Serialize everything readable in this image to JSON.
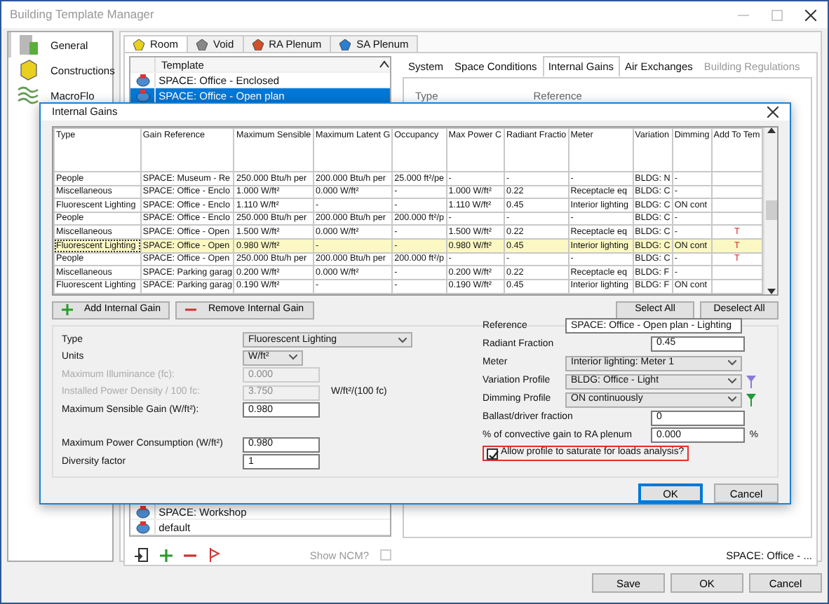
{
  "window": {
    "title": "Building Template Manager"
  },
  "sidebar": {
    "items": [
      {
        "label": "General",
        "selected": true
      },
      {
        "label": "Constructions",
        "selected": false
      },
      {
        "label": "MacroFlo",
        "selected": false
      }
    ]
  },
  "category_tabs": [
    {
      "label": "Room",
      "selected": true
    },
    {
      "label": "Void",
      "selected": false
    },
    {
      "label": "RA Plenum",
      "selected": false
    },
    {
      "label": "SA Plenum",
      "selected": false
    }
  ],
  "template_list": {
    "header": "Template",
    "items_top": [
      {
        "label": "SPACE: Office - Enclosed",
        "selected": false
      },
      {
        "label": "SPACE: Office - Open plan",
        "selected": true
      }
    ],
    "items_bottom": [
      {
        "label": "SPACE: Workshop",
        "selected": false
      },
      {
        "label": "default",
        "selected": false
      }
    ]
  },
  "detail_tabs": [
    {
      "label": "System",
      "selected": false,
      "disabled": false
    },
    {
      "label": "Space Conditions",
      "selected": false,
      "disabled": false
    },
    {
      "label": "Internal Gains",
      "selected": true,
      "disabled": false
    },
    {
      "label": "Air Exchanges",
      "selected": false,
      "disabled": false
    },
    {
      "label": "Building Regulations",
      "selected": false,
      "disabled": true
    }
  ],
  "detail_labels": [
    "Type",
    "Reference"
  ],
  "show_ncm": {
    "label": "Show NCM?",
    "checked": false,
    "disabled": true
  },
  "status_text": "SPACE: Office - ...",
  "buttons": [
    "Save",
    "OK",
    "Cancel"
  ],
  "dialog": {
    "title": "Internal Gains",
    "columns": [
      "Type",
      "Gain Reference",
      "Maximum Sensible",
      "Maximum Latent G",
      "Occupancy",
      "Max Power C",
      "Radiant Fractio",
      "Meter",
      "Variation",
      "Dimming",
      "Add To Tem"
    ],
    "rows": [
      {
        "cells": [
          "People",
          "SPACE: Museum - Re",
          "250.000 Btu/h per",
          "200.000 Btu/h per",
          "25.000 ft²/pe",
          "-",
          "-",
          "-",
          "BLDG: N",
          "-"
        ],
        "selected": false
      },
      {
        "cells": [
          "Miscellaneous",
          "SPACE: Office - Enclo",
          "1.000 W/ft²",
          "0.000 W/ft²",
          "-",
          "1.000 W/ft²",
          "0.22",
          "Receptacle eq",
          "BLDG: C",
          "-"
        ],
        "selected": false
      },
      {
        "cells": [
          "Fluorescent Lighting",
          "SPACE: Office - Enclo",
          "1.110 W/ft²",
          "-",
          "-",
          "1.110 W/ft²",
          "0.45",
          "Interior lighting",
          "BLDG: C",
          "ON cont"
        ],
        "selected": false
      },
      {
        "cells": [
          "People",
          "SPACE: Office - Enclo",
          "250.000 Btu/h per",
          "200.000 Btu/h per",
          "200.000 ft²/p",
          "-",
          "-",
          "-",
          "BLDG: C",
          "-"
        ],
        "selected": false
      },
      {
        "cells": [
          "Miscellaneous",
          "SPACE: Office - Open",
          "1.500 W/ft²",
          "0.000 W/ft²",
          "-",
          "1.500 W/ft²",
          "0.22",
          "Receptacle eq",
          "BLDG: C",
          "-"
        ],
        "selected": false,
        "flag": "T"
      },
      {
        "cells": [
          "Fluorescent Lighting",
          "SPACE: Office - Open",
          "0.980 W/ft²",
          "-",
          "-",
          "0.980 W/ft²",
          "0.45",
          "Interior lighting",
          "BLDG: C",
          "ON cont"
        ],
        "selected": true,
        "flag": "T"
      },
      {
        "cells": [
          "People",
          "SPACE: Office - Open",
          "250.000 Btu/h per",
          "200.000 Btu/h per",
          "200.000 ft²/p",
          "-",
          "-",
          "-",
          "BLDG: C",
          "-"
        ],
        "selected": false,
        "flag": "T"
      },
      {
        "cells": [
          "Miscellaneous",
          "SPACE: Parking garag",
          "0.200 W/ft²",
          "0.000 W/ft²",
          "-",
          "0.200 W/ft²",
          "0.22",
          "Receptacle eq",
          "BLDG: F",
          "-"
        ],
        "selected": false
      },
      {
        "cells": [
          "Fluorescent Lighting",
          "SPACE: Parking garag",
          "0.190 W/ft²",
          "-",
          "-",
          "0.190 W/ft²",
          "0.45",
          "Interior lighting",
          "BLDG: F",
          "ON cont"
        ],
        "selected": false
      }
    ],
    "add_button": "Add Internal Gain",
    "remove_button": "Remove Internal Gain",
    "select_buttons": [
      "Select All",
      "Deselect All"
    ],
    "left_fields": [
      {
        "kind": "select",
        "label": "Type",
        "value": "Fluorescent Lighting",
        "disabled": false
      },
      {
        "kind": "select",
        "label": "Units",
        "value": "W/ft²",
        "disabled": false
      },
      {
        "kind": "input",
        "label": "Maximum Illuminance (fc):",
        "value": "0.000",
        "disabled": true
      },
      {
        "kind": "input",
        "label": "Installed Power Density / 100 fc:",
        "value": "3.750",
        "disabled": true,
        "unit": "W/ft²/(100 fc)"
      },
      {
        "kind": "input",
        "label": "Maximum Sensible Gain (W/ft²):",
        "value": "0.980",
        "disabled": false
      },
      {
        "kind": "spacer"
      },
      {
        "kind": "input",
        "label": "Maximum Power Consumption (W/ft²)",
        "value": "0.980",
        "disabled": false
      },
      {
        "kind": "input",
        "label": "Diversity factor",
        "value": "1",
        "disabled": false
      }
    ],
    "right_fields": [
      {
        "kind": "input",
        "label": "Reference",
        "value": "SPACE: Office - Open plan - Lighting",
        "disabled": false
      },
      {
        "kind": "input_short",
        "label": "Radiant Fraction",
        "value": "0.45",
        "disabled": false
      },
      {
        "kind": "select",
        "label": "Meter",
        "value": "Interior lighting: Meter 1",
        "disabled": false
      },
      {
        "kind": "select",
        "label": "Variation Profile",
        "value": "BLDG: Office - Light",
        "disabled": false,
        "color": "#8a7ad8"
      },
      {
        "kind": "select",
        "label": "Dimming Profile",
        "value": "ON continuously",
        "disabled": false,
        "color": "#1e9a3a"
      },
      {
        "kind": "input_short",
        "label": "Ballast/driver fraction",
        "value": "0",
        "disabled": false
      },
      {
        "kind": "input_short",
        "label": "% of convective gain to RA plenum",
        "value": "0.000",
        "disabled": false,
        "unit": "%"
      }
    ],
    "checkbox": {
      "label": "Allow profile to saturate for loads analysis?",
      "checked": true
    },
    "buttons": [
      "OK",
      "Cancel"
    ]
  }
}
